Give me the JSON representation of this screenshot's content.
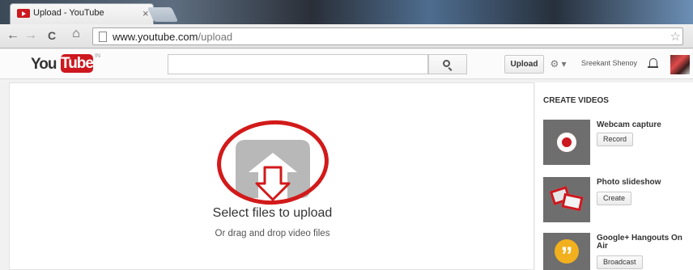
{
  "browser": {
    "tab_title": "Upload - YouTube",
    "tab_close": "×",
    "back": "←",
    "forward": "→",
    "reload": "C",
    "home": "⌂",
    "url_host": "www.youtube.com",
    "url_path": "/upload",
    "bookmark_star": "☆"
  },
  "header": {
    "logo_you": "You",
    "logo_tube": "Tube",
    "logo_country": "IN",
    "search_value": "",
    "upload_label": "Upload",
    "settings_label": "⚙ ▾",
    "username": "Sreekant Shenoy"
  },
  "upload": {
    "select_files": "Select files to upload",
    "drag_drop": "Or drag and drop video files"
  },
  "create_videos": {
    "title": "CREATE VIDEOS",
    "items": [
      {
        "title": "Webcam capture",
        "button": "Record"
      },
      {
        "title": "Photo slideshow",
        "button": "Create"
      },
      {
        "title": "Google+ Hangouts On Air",
        "button": "Broadcast"
      }
    ]
  },
  "colors": {
    "accent": "#cc181e",
    "annotation_circle": "#d21a1a",
    "hangout_yellow": "#f2b01e"
  },
  "icons": [
    "youtube-favicon",
    "back-arrow-icon",
    "forward-arrow-icon",
    "reload-icon",
    "home-icon",
    "page-icon",
    "star-icon",
    "search-icon",
    "gear-icon",
    "bell-icon",
    "upload-arrow-icon",
    "record-icon",
    "photo-icon",
    "hangouts-icon"
  ]
}
